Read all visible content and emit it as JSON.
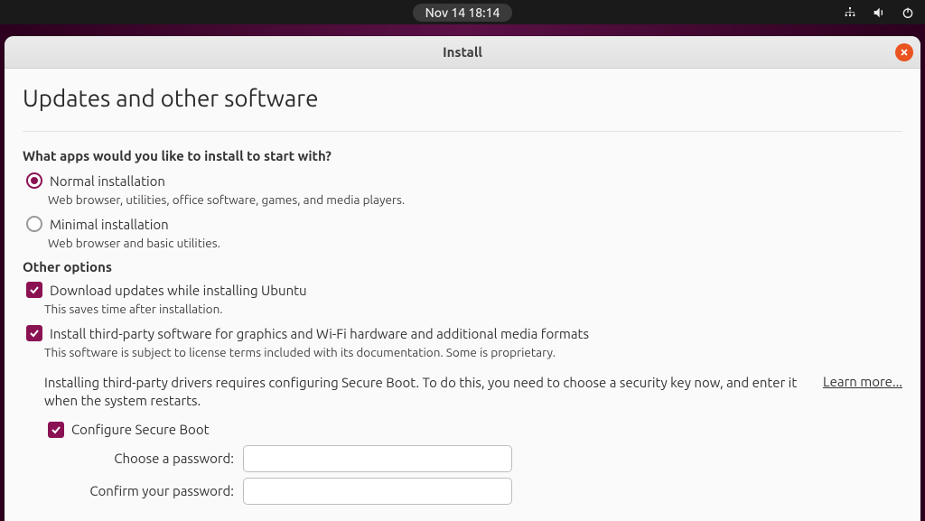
{
  "system_bar": {
    "clock": "Nov 14  18:14"
  },
  "window": {
    "title": "Install",
    "page_heading": "Updates and other software",
    "apps_question": "What apps would you like to install to start with?",
    "normal": {
      "label": "Normal installation",
      "desc": "Web browser, utilities, office software, games, and media players."
    },
    "minimal": {
      "label": "Minimal installation",
      "desc": "Web browser and basic utilities."
    },
    "other_heading": "Other options",
    "download_updates": {
      "label": "Download updates while installing Ubuntu",
      "desc": "This saves time after installation."
    },
    "third_party": {
      "label": "Install third-party software for graphics and Wi-Fi hardware and additional media formats",
      "desc": "This software is subject to license terms included with its documentation. Some is proprietary.",
      "secure_boot_note": "Installing third-party drivers requires configuring Secure Boot. To do this, you need to choose a security key now, and enter it when the system restarts."
    },
    "learn_more": "Learn more...",
    "secure_boot": {
      "label": "Configure Secure Boot",
      "choose_pw": "Choose a password:",
      "confirm_pw": "Confirm your password:",
      "choose_pw_value": "",
      "confirm_pw_value": ""
    }
  }
}
